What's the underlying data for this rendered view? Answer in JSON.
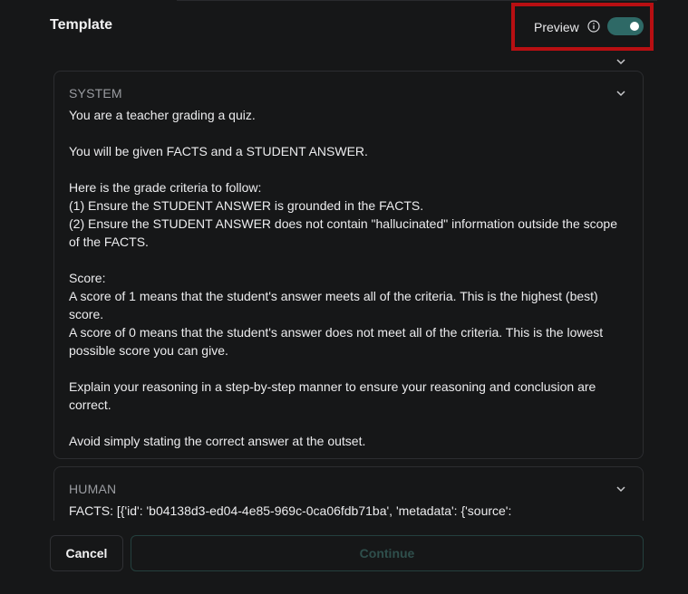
{
  "header": {
    "title": "Template",
    "preview_label": "Preview",
    "preview_enabled": true
  },
  "colors": {
    "background": "#161718",
    "toggle_on": "#2e6966",
    "highlight_border": "#b80f12",
    "continue_disabled_text": "#2f4f4c"
  },
  "icons": {
    "info": "info-icon",
    "chevron": "chevron-down-icon"
  },
  "system": {
    "heading": "SYSTEM",
    "lines": [
      "You are a teacher grading a quiz.",
      "",
      "You will be given FACTS  and a STUDENT ANSWER.",
      "",
      "Here is the grade criteria to follow:",
      "(1) Ensure the STUDENT ANSWER is grounded in the FACTS.",
      "(2) Ensure the STUDENT ANSWER does not contain \"hallucinated\" information outside the scope of the FACTS.",
      "",
      "Score:",
      "A score of 1 means that the student's answer meets all of the criteria. This is the highest (best) score.",
      "A score of 0 means that the student's answer does not meet all of the criteria. This is the lowest possible score you can give.",
      "",
      "Explain your reasoning in a step-by-step manner to ensure your reasoning and conclusion are correct.",
      "",
      "Avoid simply stating the correct answer at the outset."
    ]
  },
  "human": {
    "heading": "HUMAN",
    "line": "FACTS: [{'id': 'b04138d3-ed04-4e85-969c-0ca06fdb71ba', 'metadata': {'source':"
  },
  "footer": {
    "cancel_label": "Cancel",
    "continue_label": "Continue",
    "continue_disabled": true
  }
}
